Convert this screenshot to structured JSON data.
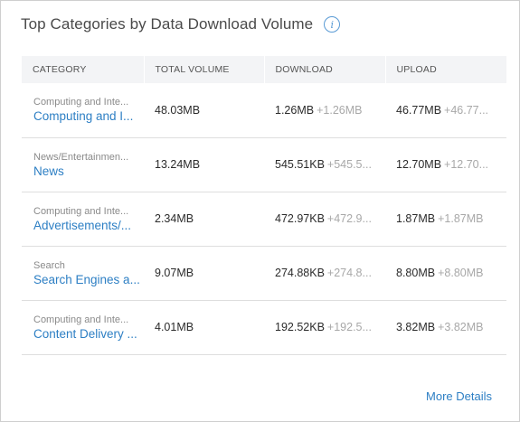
{
  "widget": {
    "title": "Top Categories by Data Download Volume",
    "info_icon": "info-icon",
    "more_label": "More Details"
  },
  "table": {
    "headers": [
      "CATEGORY",
      "TOTAL VOLUME",
      "DOWNLOAD",
      "UPLOAD"
    ],
    "rows": [
      {
        "parent": "Computing and Inte...",
        "category": "Computing and I...",
        "total": "48.03MB",
        "download": "1.26MB",
        "download_delta": "+1.26MB",
        "upload": "46.77MB",
        "upload_delta": "+46.77..."
      },
      {
        "parent": "News/Entertainmen...",
        "category": "News",
        "total": "13.24MB",
        "download": "545.51KB",
        "download_delta": "+545.5...",
        "upload": "12.70MB",
        "upload_delta": "+12.70..."
      },
      {
        "parent": "Computing and Inte...",
        "category": "Advertisements/...",
        "total": "2.34MB",
        "download": "472.97KB",
        "download_delta": "+472.9...",
        "upload": "1.87MB",
        "upload_delta": "+1.87MB"
      },
      {
        "parent": "Search",
        "category": "Search Engines a...",
        "total": "9.07MB",
        "download": "274.88KB",
        "download_delta": "+274.8...",
        "upload": "8.80MB",
        "upload_delta": "+8.80MB"
      },
      {
        "parent": "Computing and Inte...",
        "category": "Content Delivery ...",
        "total": "4.01MB",
        "download": "192.52KB",
        "download_delta": "+192.5...",
        "upload": "3.82MB",
        "upload_delta": "+3.82MB"
      }
    ]
  },
  "colors": {
    "link": "#2d7fc4",
    "header_bg": "#f3f4f6",
    "muted": "#a8a8a8"
  }
}
